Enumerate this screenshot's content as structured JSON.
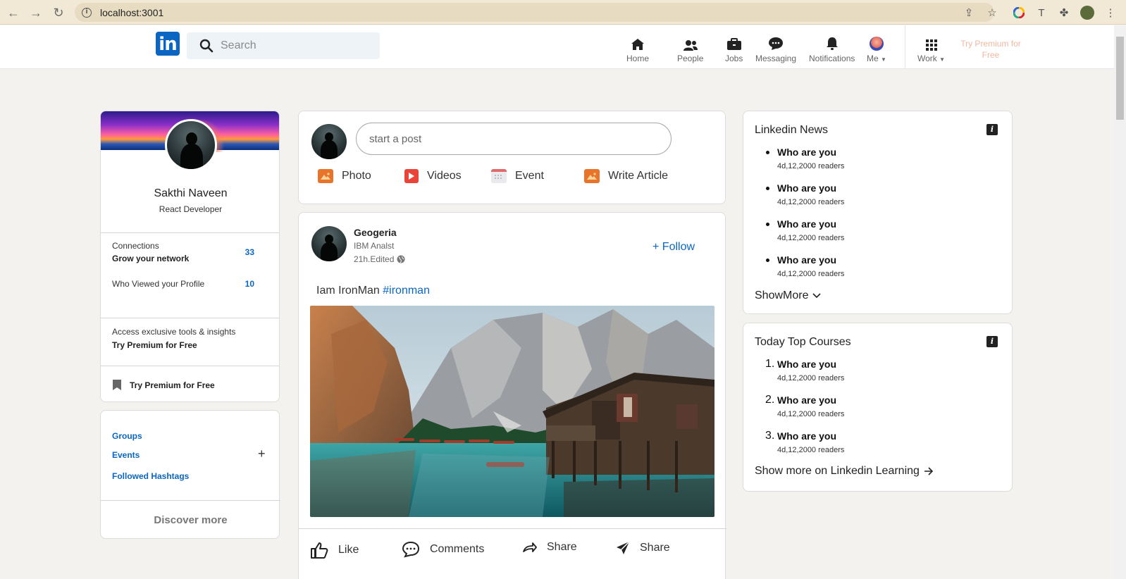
{
  "browser": {
    "url": "localhost:3001"
  },
  "header": {
    "search_placeholder": "Search",
    "nav": [
      {
        "label": "Home",
        "icon": "home-icon"
      },
      {
        "label": "People",
        "icon": "people-icon"
      },
      {
        "label": "Jobs",
        "icon": "briefcase-icon"
      },
      {
        "label": "Messaging",
        "icon": "messaging-icon"
      },
      {
        "label": "Notifications",
        "icon": "bell-icon"
      },
      {
        "label": "Me",
        "icon": "avatar"
      },
      {
        "label": "Work",
        "icon": "grid-icon"
      }
    ],
    "premium": "Try Premium for Free"
  },
  "profile": {
    "name": "Sakthi Naveen",
    "title": "React Developer",
    "connections_label": "Connections",
    "connections_sub": "Grow your network",
    "connections_count": "33",
    "viewed_label": "Who Viewed your Profile",
    "viewed_count": "10",
    "premium_note": "Access exclusive tools & insights",
    "premium_link": "Try Premium for Free",
    "bookmark_label": "Try Premium for Free"
  },
  "sidebar_links": {
    "groups": "Groups",
    "events": "Events",
    "hashtags": "Followed Hashtags",
    "discover": "Discover more"
  },
  "start_post": {
    "placeholder": "start a post",
    "actions": [
      "Photo",
      "Videos",
      "Event",
      "Write Article"
    ]
  },
  "post": {
    "author": "Geogeria",
    "role": "IBM Analst",
    "time": "21h.Edited",
    "follow": "+ Follow",
    "text": "Iam IronMan",
    "hashtag": "#ironman",
    "reactions": [
      "Like",
      "Comments",
      "Share",
      "Share"
    ]
  },
  "news": {
    "title": "Linkedin News",
    "items": [
      {
        "headline": "Who are you",
        "meta": "4d,12,2000 readers"
      },
      {
        "headline": "Who are you",
        "meta": "4d,12,2000 readers"
      },
      {
        "headline": "Who are you",
        "meta": "4d,12,2000 readers"
      },
      {
        "headline": "Who are you",
        "meta": "4d,12,2000 readers"
      }
    ],
    "show_more": "ShowMore"
  },
  "courses": {
    "title": "Today Top Courses",
    "items": [
      {
        "num": "1.",
        "headline": "Who are you",
        "meta": "4d,12,2000 readers"
      },
      {
        "num": "2.",
        "headline": "Who are you",
        "meta": "4d,12,2000 readers"
      },
      {
        "num": "3.",
        "headline": "Who are you",
        "meta": "4d,12,2000 readers"
      }
    ],
    "show_more": "Show more on Linkedin Learning"
  },
  "colors": {
    "brand": "#0a66c2",
    "background": "#f3f2ef"
  }
}
